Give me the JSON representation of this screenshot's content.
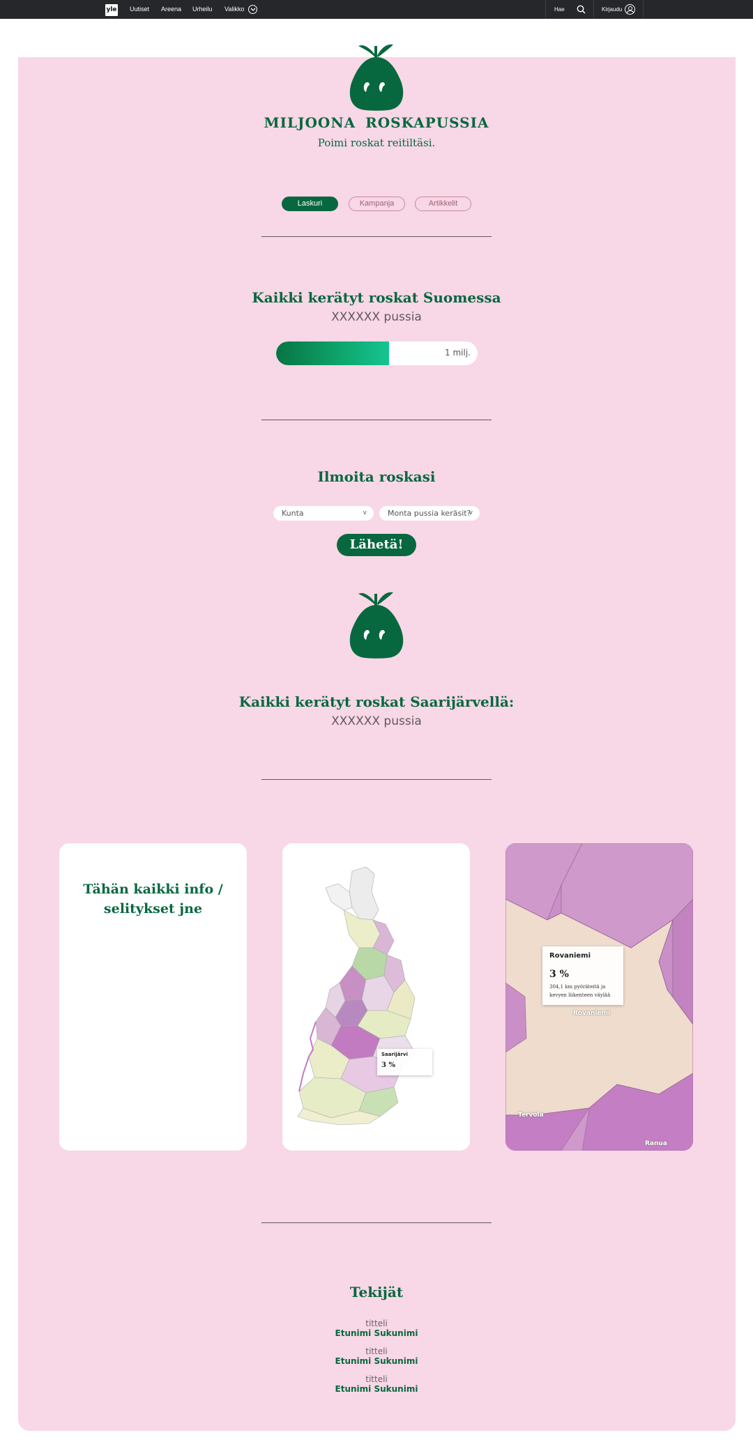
{
  "nav": {
    "logo": "yle",
    "links": [
      "Uutiset",
      "Areena",
      "Urheilu",
      "Valikko"
    ],
    "search_label": "Hae",
    "login_label": "Kirjaudu"
  },
  "header": {
    "title": "MILJOONA ROSKAPUSSIA",
    "subtitle": "Poimi roskat reitiltäsi."
  },
  "tabs": [
    {
      "label": "Laskuri",
      "active": true
    },
    {
      "label": "Kampanja",
      "active": false
    },
    {
      "label": "Artikkelit",
      "active": false
    }
  ],
  "total": {
    "heading": "Kaikki kerätyt roskat Suomessa",
    "count": "XXXXXX pussia",
    "progress_fraction": 0.56,
    "goal_label": "1 milj."
  },
  "report": {
    "heading": "Ilmoita roskasi",
    "municipality_select": "Kunta",
    "bags_select": "Monta pussia keräsit?",
    "submit_label": "Lähetä!"
  },
  "local": {
    "heading": "Kaikki kerätyt roskat Saarijärvellä:",
    "count": "XXXXXX pussia"
  },
  "cards": {
    "info_title": "Tähän kaikki info / selitykset jne",
    "map_tooltip": {
      "name": "Saarijärvi",
      "value": "3 %"
    },
    "zoom_tooltip": {
      "name": "Rovaniemi",
      "value": "3 %",
      "detail": "304,1 km pyöräteitä ja kevyen liikenteen väylää"
    },
    "zoom_labels": [
      "Rovaniemi",
      "Tervola",
      "Ranua"
    ]
  },
  "credits": {
    "heading": "Tekijät",
    "people": [
      {
        "title": "titteli",
        "name": "Etunimi Sukunimi"
      },
      {
        "title": "titteli",
        "name": "Etunimi Sukunimi"
      },
      {
        "title": "titteli",
        "name": "Etunimi Sukunimi"
      }
    ]
  },
  "colors": {
    "brand_green": "#07683f",
    "pink": "#f8d7e6",
    "nav_dark": "#25272b"
  }
}
